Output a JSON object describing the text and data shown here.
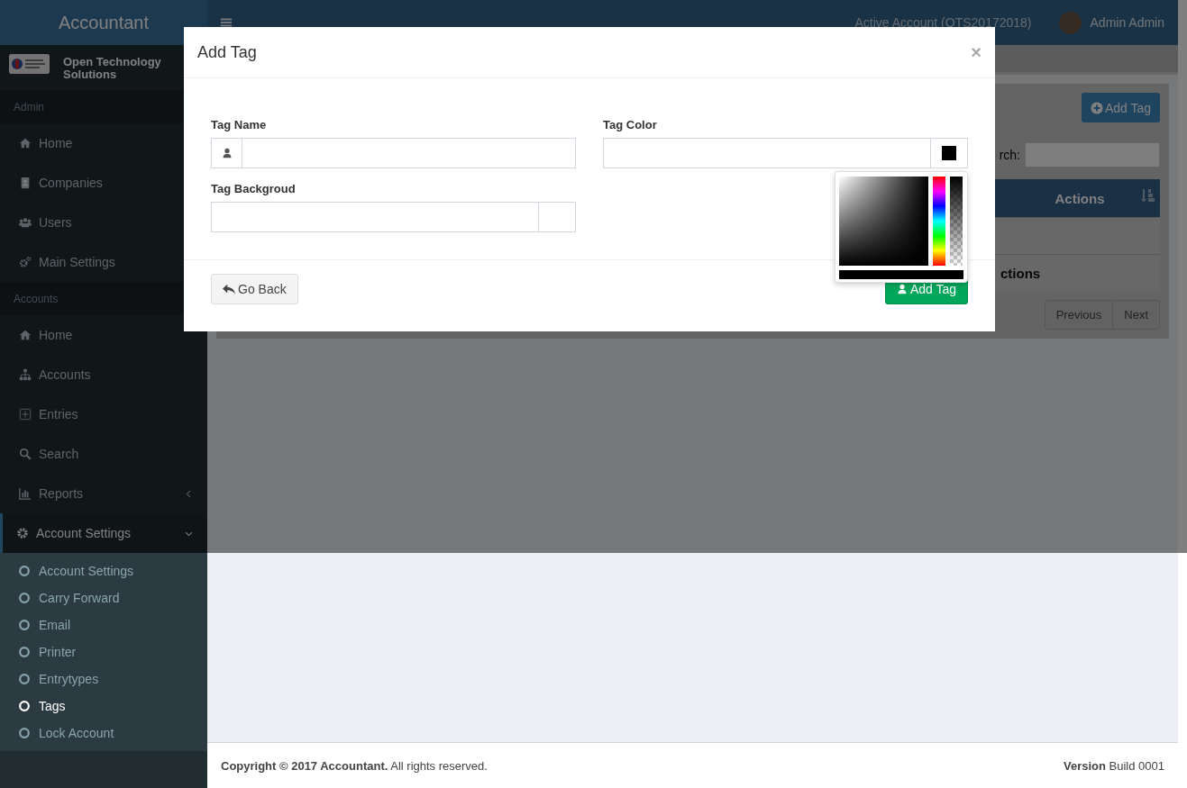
{
  "app": {
    "logo": "Accountant"
  },
  "topbar": {
    "active_account": "Active Account (OTS20172018)",
    "user_name": "Admin Admin"
  },
  "sidebar": {
    "company": "Open Technology Solutions",
    "sections": [
      {
        "header": "Admin",
        "items": [
          {
            "label": "Home",
            "selected": false
          },
          {
            "label": "Companies",
            "selected": false
          },
          {
            "label": "Users",
            "selected": false
          },
          {
            "label": "Main Settings",
            "selected": false
          }
        ]
      },
      {
        "header": "Accounts",
        "items": [
          {
            "label": "Home",
            "selected": false
          },
          {
            "label": "Accounts",
            "selected": false
          },
          {
            "label": "Entries",
            "selected": false
          },
          {
            "label": "Search",
            "selected": false
          },
          {
            "label": "Reports",
            "selected": false,
            "expanded": false
          },
          {
            "label": "Account Settings",
            "selected": true,
            "expanded": true,
            "children": [
              {
                "label": "Account Settings",
                "selected": false
              },
              {
                "label": "Carry Forward",
                "selected": false
              },
              {
                "label": "Email",
                "selected": false
              },
              {
                "label": "Printer",
                "selected": false
              },
              {
                "label": "Entrytypes",
                "selected": false
              },
              {
                "label": "Tags",
                "selected": true
              },
              {
                "label": "Lock Account",
                "selected": false
              }
            ]
          }
        ]
      }
    ]
  },
  "content": {
    "add_button": "Add Tag",
    "search_label": "rch:",
    "table": {
      "columns": [
        "Actions"
      ],
      "footer": [
        "ctions"
      ]
    },
    "pagination": [
      {
        "label": "Previous"
      },
      {
        "label": "Next"
      }
    ]
  },
  "modal": {
    "title": "Add Tag",
    "close": "×",
    "fields": [
      {
        "label": "Tag Name",
        "kind": "icon"
      },
      {
        "label": "Tag Color",
        "kind": "color",
        "color": "#000000",
        "picker_open": true
      },
      {
        "label": "Tag Backgroud",
        "kind": "empty"
      }
    ],
    "buttons": [
      {
        "label": "Go Back",
        "kind": "default"
      },
      {
        "label": "Add Tag",
        "kind": "success"
      }
    ]
  },
  "footer": {
    "copyright": "**Copyright © 2017 Accountant.** All rights reserved.",
    "version": "**Version** Build 0001"
  }
}
